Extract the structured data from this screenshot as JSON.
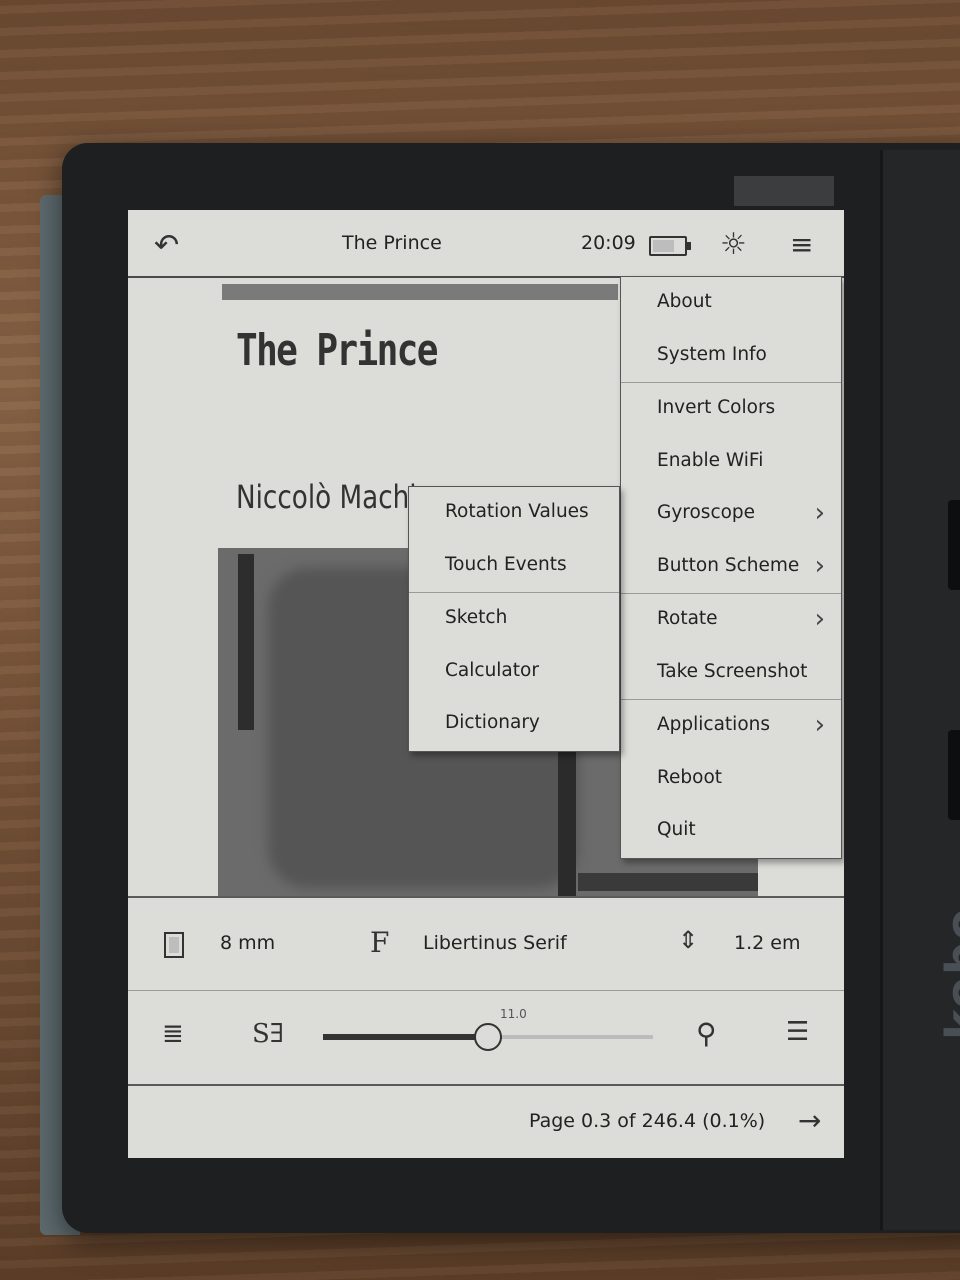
{
  "top_bar": {
    "back_icon": "back-arrow-icon",
    "title": "The Prince",
    "time": "20:09",
    "battery_level": 0.7,
    "frontlight_icon": "sun-icon",
    "menu_icon": "hamburger-icon"
  },
  "book": {
    "title": "The Prince",
    "author": "Niccolò Machia"
  },
  "main_menu": {
    "items": [
      {
        "label": "About",
        "submenu": false
      },
      {
        "label": "System Info",
        "submenu": false
      },
      {
        "label": "Invert Colors",
        "submenu": false
      },
      {
        "label": "Enable WiFi",
        "submenu": false
      },
      {
        "label": "Gyroscope",
        "submenu": true
      },
      {
        "label": "Button Scheme",
        "submenu": true
      },
      {
        "label": "Rotate",
        "submenu": true
      },
      {
        "label": "Take Screenshot",
        "submenu": false
      },
      {
        "label": "Applications",
        "submenu": true
      },
      {
        "label": "Reboot",
        "submenu": false
      },
      {
        "label": "Quit",
        "submenu": false
      }
    ]
  },
  "applications_menu": {
    "items": [
      {
        "label": "Rotation Values"
      },
      {
        "label": "Touch Events"
      },
      {
        "label": "Sketch"
      },
      {
        "label": "Calculator"
      },
      {
        "label": "Dictionary"
      }
    ]
  },
  "toolbar": {
    "margin_value": "8 mm",
    "font_icon_glyph": "F",
    "font_name": "Libertinus Serif",
    "line_height_value": "1.2 em",
    "font_size_value": "11.0",
    "font_size_fraction": 0.5,
    "font_size_glyph": "S∃"
  },
  "footer": {
    "page_label": "Page 0.3 of 246.4 (0.1%)"
  }
}
